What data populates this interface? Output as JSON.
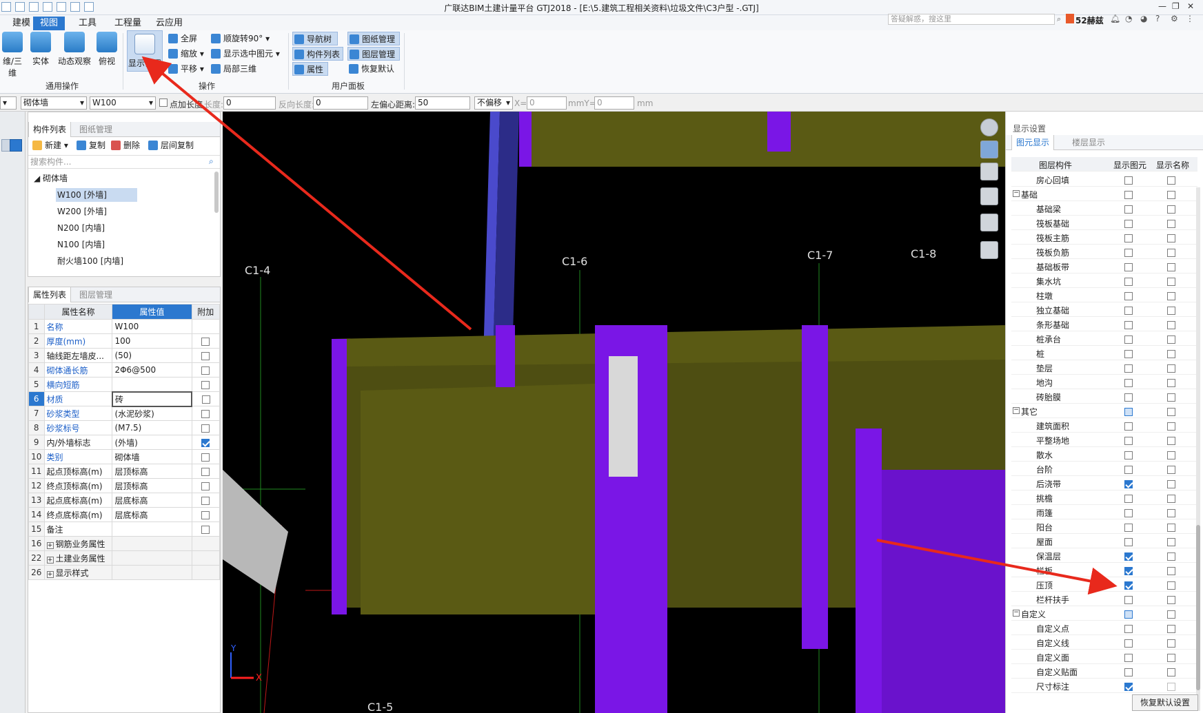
{
  "titlebar": {
    "title": "广联达BIM土建计量平台 GTJ2018 - [E:\\5.建筑工程相关资料\\垃圾文件\\C3户型 -.GTJ]"
  },
  "tabs": [
    "建模",
    "视图",
    "工具",
    "工程量",
    "云应用"
  ],
  "search": {
    "placeholder": "答疑解惑，搜这里"
  },
  "user": {
    "name": "52赫兹"
  },
  "ribbon": {
    "general": {
      "title": "通用操作",
      "buttons": [
        "维/三维",
        "实体",
        "动态观察",
        "俯视"
      ]
    },
    "ops": {
      "title": "操作",
      "display_settings": "显示设置",
      "fullscreen": "全屏",
      "zoom": "缩放",
      "pan": "平移",
      "rotate": "顺旋转90°",
      "show_selected": "显示选中图元",
      "local3d": "局部三维"
    },
    "user_panel": {
      "title": "用户面板",
      "nav_tree": "导航树",
      "drawing_mgmt": "图纸管理",
      "comp_list": "构件列表",
      "layer_mgmt": "图层管理",
      "properties": "属性",
      "restore_default": "恢复默认"
    }
  },
  "propbar": {
    "type": "砌体墙",
    "name": "W100",
    "point_len_label": "点加长度",
    "len_label": "长度:",
    "len_value": "0",
    "rev_label": "反向长度:",
    "rev_value": "0",
    "offset_label": "左偏心距离:",
    "offset_value": "50",
    "mode": "不偏移",
    "x_label": "X=",
    "x_value": "0",
    "mmy_label": "mmY=",
    "y_value": "0",
    "mm": "mm"
  },
  "comp_panel": {
    "tabs": [
      "构件列表",
      "图纸管理"
    ],
    "toolbar": [
      "新建",
      "复制",
      "删除",
      "层间复制"
    ],
    "search_placeholder": "搜索构件...",
    "root": "砌体墙",
    "items": [
      "W100 [外墙]",
      "W200 [外墙]",
      "N200 [内墙]",
      "N100 [内墙]",
      "耐火墙100 [内墙]"
    ]
  },
  "prop_panel": {
    "tabs": [
      "属性列表",
      "图层管理"
    ],
    "headers": [
      "属性名称",
      "属性值",
      "附加"
    ],
    "rows": [
      {
        "n": "1",
        "name": "名称",
        "val": "W100",
        "ck": "none",
        "blue": true
      },
      {
        "n": "2",
        "name": "厚度(mm)",
        "val": "100",
        "ck": "off",
        "blue": true
      },
      {
        "n": "3",
        "name": "轴线距左墙皮...",
        "val": "(50)",
        "ck": "off",
        "blue": false
      },
      {
        "n": "4",
        "name": "砌体通长筋",
        "val": "2Φ6@500",
        "ck": "off",
        "blue": true
      },
      {
        "n": "5",
        "name": "横向短筋",
        "val": "",
        "ck": "off",
        "blue": true
      },
      {
        "n": "6",
        "name": "材质",
        "val": "砖",
        "ck": "off",
        "blue": true
      },
      {
        "n": "7",
        "name": "砂浆类型",
        "val": "(水泥砂浆)",
        "ck": "off",
        "blue": true
      },
      {
        "n": "8",
        "name": "砂浆标号",
        "val": "(M7.5)",
        "ck": "off",
        "blue": true
      },
      {
        "n": "9",
        "name": "内/外墙标志",
        "val": "(外墙)",
        "ck": "on",
        "blue": false
      },
      {
        "n": "10",
        "name": "类别",
        "val": "砌体墙",
        "ck": "off",
        "blue": true
      },
      {
        "n": "11",
        "name": "起点顶标高(m)",
        "val": "层顶标高",
        "ck": "off",
        "blue": false
      },
      {
        "n": "12",
        "name": "终点顶标高(m)",
        "val": "层顶标高",
        "ck": "off",
        "blue": false
      },
      {
        "n": "13",
        "name": "起点底标高(m)",
        "val": "层底标高",
        "ck": "off",
        "blue": false
      },
      {
        "n": "14",
        "name": "终点底标高(m)",
        "val": "层底标高",
        "ck": "off",
        "blue": false
      },
      {
        "n": "15",
        "name": "备注",
        "val": "",
        "ck": "off",
        "blue": false
      },
      {
        "n": "16",
        "name": "钢筋业务属性",
        "val": "",
        "ck": "none",
        "blue": false
      },
      {
        "n": "22",
        "name": "土建业务属性",
        "val": "",
        "ck": "none",
        "blue": false
      },
      {
        "n": "26",
        "name": "显示样式",
        "val": "",
        "ck": "none",
        "blue": false
      }
    ]
  },
  "viewport": {
    "axes": [
      "C1-4",
      "C1-6",
      "C1-7",
      "C1-8",
      "C1-5"
    ],
    "x_axis": "X",
    "y_axis": "Y"
  },
  "display_panel": {
    "title": "显示设置",
    "tabs": [
      "图元显示",
      "楼层显示"
    ],
    "headers": [
      "图层构件",
      "显示图元",
      "显示名称"
    ],
    "rows": [
      {
        "name": "房心回填",
        "lvl": 1,
        "a": "off",
        "b": "off"
      },
      {
        "name": "基础",
        "lvl": 0,
        "a": "off",
        "b": "off"
      },
      {
        "name": "基础梁",
        "lvl": 1,
        "a": "off",
        "b": "off"
      },
      {
        "name": "筏板基础",
        "lvl": 1,
        "a": "off",
        "b": "off"
      },
      {
        "name": "筏板主筋",
        "lvl": 1,
        "a": "off",
        "b": "off"
      },
      {
        "name": "筏板负筋",
        "lvl": 1,
        "a": "off",
        "b": "off"
      },
      {
        "name": "基础板带",
        "lvl": 1,
        "a": "off",
        "b": "off"
      },
      {
        "name": "集水坑",
        "lvl": 1,
        "a": "off",
        "b": "off"
      },
      {
        "name": "柱墩",
        "lvl": 1,
        "a": "off",
        "b": "off"
      },
      {
        "name": "独立基础",
        "lvl": 1,
        "a": "off",
        "b": "off"
      },
      {
        "name": "条形基础",
        "lvl": 1,
        "a": "off",
        "b": "off"
      },
      {
        "name": "桩承台",
        "lvl": 1,
        "a": "off",
        "b": "off"
      },
      {
        "name": "桩",
        "lvl": 1,
        "a": "off",
        "b": "off"
      },
      {
        "name": "垫层",
        "lvl": 1,
        "a": "off",
        "b": "off"
      },
      {
        "name": "地沟",
        "lvl": 1,
        "a": "off",
        "b": "off"
      },
      {
        "name": "砖胎膜",
        "lvl": 1,
        "a": "off",
        "b": "off"
      },
      {
        "name": "其它",
        "lvl": 0,
        "a": "part",
        "b": "off"
      },
      {
        "name": "建筑面积",
        "lvl": 1,
        "a": "off",
        "b": "off"
      },
      {
        "name": "平整场地",
        "lvl": 1,
        "a": "off",
        "b": "off"
      },
      {
        "name": "散水",
        "lvl": 1,
        "a": "off",
        "b": "off"
      },
      {
        "name": "台阶",
        "lvl": 1,
        "a": "off",
        "b": "off"
      },
      {
        "name": "后浇带",
        "lvl": 1,
        "a": "on",
        "b": "off"
      },
      {
        "name": "挑檐",
        "lvl": 1,
        "a": "off",
        "b": "off"
      },
      {
        "name": "雨篷",
        "lvl": 1,
        "a": "off",
        "b": "off"
      },
      {
        "name": "阳台",
        "lvl": 1,
        "a": "off",
        "b": "off"
      },
      {
        "name": "屋面",
        "lvl": 1,
        "a": "off",
        "b": "off"
      },
      {
        "name": "保温层",
        "lvl": 1,
        "a": "on",
        "b": "off"
      },
      {
        "name": "栏板",
        "lvl": 1,
        "a": "on",
        "b": "off"
      },
      {
        "name": "压顶",
        "lvl": 1,
        "a": "on",
        "b": "off"
      },
      {
        "name": "栏杆扶手",
        "lvl": 1,
        "a": "off",
        "b": "off"
      },
      {
        "name": "自定义",
        "lvl": 0,
        "a": "part",
        "b": "off"
      },
      {
        "name": "自定义点",
        "lvl": 1,
        "a": "off",
        "b": "off"
      },
      {
        "name": "自定义线",
        "lvl": 1,
        "a": "off",
        "b": "off"
      },
      {
        "name": "自定义面",
        "lvl": 1,
        "a": "off",
        "b": "off"
      },
      {
        "name": "自定义贴面",
        "lvl": 1,
        "a": "off",
        "b": "off"
      },
      {
        "name": "尺寸标注",
        "lvl": 1,
        "a": "on",
        "b": "dis"
      }
    ],
    "restore_button": "恢复默认设置"
  },
  "colors": {
    "wall_olive": "#5a5a14",
    "column_purple": "#7a16e6",
    "accent_blue": "#2b78cf",
    "arrow_red": "#e8291c"
  }
}
